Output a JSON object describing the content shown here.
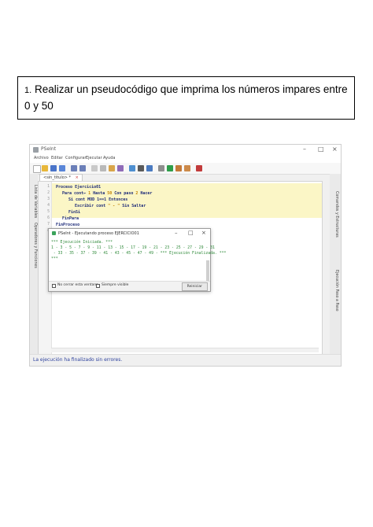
{
  "task": {
    "number": "1.",
    "text": "Realizar un pseudocódigo que imprima los números impares entre 0 y 50"
  },
  "app": {
    "title": "PSeInt",
    "menu": [
      "Archivo",
      "Editar",
      "Configurar",
      "Ejecutar",
      "Ayuda"
    ],
    "tab_label": "<sin_titulo> *",
    "left_panels": [
      "Lista de Variables",
      "Operadores y Funciones"
    ],
    "right_panels": [
      "Comandos y Estructuras",
      "Ejecución Paso a Paso"
    ],
    "line_numbers": [
      "1",
      "2",
      "3",
      "4",
      "5",
      "6",
      "7",
      "8"
    ],
    "code": {
      "l1": "Proceso Ejercicio01",
      "l2a": "Para cont← ",
      "l2b": "1",
      "l2c": " Hasta ",
      "l2d": "50",
      "l2e": " Con paso ",
      "l2f": "2",
      "l2g": " Hacer",
      "l3": "Si cont MOD 1==1 Entonces",
      "l4a": "Escribir cont ",
      "l4b": "\" - \"",
      "l4c": " Sin Saltar",
      "l5": "FinSi",
      "l6": "FinPara",
      "l7": "FinProceso"
    },
    "status": "La ejecución ha finalizado sin errores."
  },
  "dialog": {
    "title": "PSeInt - Ejecutando proceso EJERCICIO01",
    "console_lines": [
      "*** Ejecución Iniciada. ***",
      "1 - 3 - 5 - 7 - 9 - 11 - 13 - 15 - 17 - 19 - 21 - 23 - 25 - 27 - 29 - 31",
      " - 33 - 35 - 37 - 39 - 41 - 43 - 45 - 47 - 49 - *** Ejecución Finalizada. ***",
      "***"
    ],
    "checkbox_close": "No cerrar esta ventana",
    "checkbox_top": "Siempre visible",
    "restart_label": "Reiniciar"
  },
  "colors": {
    "keyword": "#1c2a78",
    "number": "#c08000",
    "console_text": "#2f8a3a",
    "highlight": "#fbf6c6",
    "status_text": "#2b3f9c"
  }
}
